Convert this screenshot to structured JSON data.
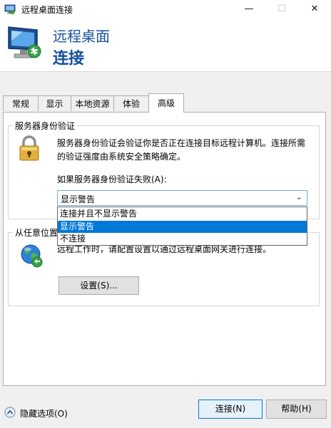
{
  "window": {
    "title": "远程桌面连接",
    "minimize_glyph": "—",
    "maximize_glyph": "☐",
    "close_glyph": "✕"
  },
  "banner": {
    "line1": "远程桌面",
    "line2": "连接",
    "icon": "remote-desktop-monitor-icon"
  },
  "tabs": [
    {
      "label": "常规"
    },
    {
      "label": "显示"
    },
    {
      "label": "本地资源"
    },
    {
      "label": "体验"
    },
    {
      "label": "高级",
      "selected": true
    }
  ],
  "server_auth": {
    "group_title": "服务器身份验证",
    "description": "服务器身份验证会验证你是否正在连接目标远程计算机。连接所需的验证强度由系统安全策略确定。",
    "fail_label": "如果服务器身份验证失败(A):",
    "selected_value": "显示警告",
    "options": [
      "连接并且不显示警告",
      "显示警告",
      "不连接"
    ],
    "highlighted_option_index": 1,
    "icon": "padlock-icon"
  },
  "gateway": {
    "group_title": "从任意位置连接",
    "description": "远程工作时，请配置设置以通过远程桌面网关进行连接。",
    "settings_button": "设置(S)...",
    "icon": "globe-network-icon"
  },
  "footer": {
    "options_label": "隐藏选项(O)",
    "connect_button": "连接(N)",
    "help_button": "帮助(H)"
  },
  "colors": {
    "accent": "#0078d7",
    "banner_text": "#14509c",
    "background": "#f0f0f0"
  }
}
